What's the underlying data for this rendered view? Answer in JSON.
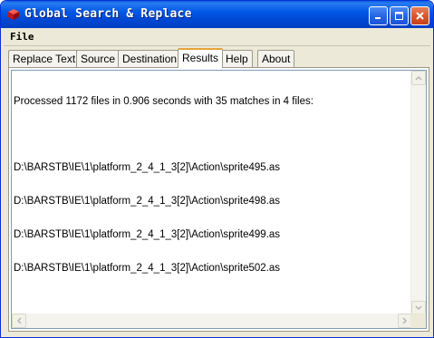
{
  "window": {
    "title": "Global Search & Replace"
  },
  "menu": {
    "file": "File"
  },
  "tabs": [
    {
      "label": "Replace Text"
    },
    {
      "label": "Source"
    },
    {
      "label": "Destination"
    },
    {
      "label": "Results"
    },
    {
      "label": "Help"
    },
    {
      "label": "About"
    }
  ],
  "active_tab": "Results",
  "results": {
    "summary": "Processed 1172 files in 0.906 seconds with 35 matches in 4 files:",
    "files": [
      "D:\\BARSTB\\IE\\1\\platform_2_4_1_3[2]\\Action\\sprite495.as",
      "D:\\BARSTB\\IE\\1\\platform_2_4_1_3[2]\\Action\\sprite498.as",
      "D:\\BARSTB\\IE\\1\\platform_2_4_1_3[2]\\Action\\sprite499.as",
      "D:\\BARSTB\\IE\\1\\platform_2_4_1_3[2]\\Action\\sprite502.as"
    ]
  },
  "colors": {
    "titlebar": "#0058e6",
    "window_bg": "#ece9d8",
    "close_button": "#d9542a",
    "active_tab_highlight": "#e6a23c"
  },
  "icons": {
    "app": "cube-icon",
    "minimize": "minimize-icon",
    "maximize": "maximize-icon",
    "close": "close-icon"
  }
}
